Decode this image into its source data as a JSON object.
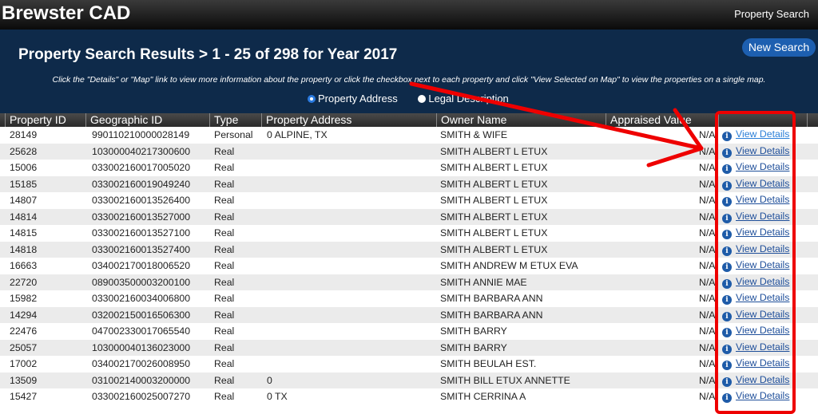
{
  "app": {
    "title": "Brewster CAD",
    "nav_property_search": "Property Search"
  },
  "panel": {
    "results_title": "Property Search Results > 1 - 25 of 298 for Year 2017",
    "new_search": "New Search",
    "instructions": "Click the \"Details\" or \"Map\" link to view more information about the property or click the checkbox next to each property and click \"View Selected on Map\" to view the properties on a single map.",
    "radio_address": "Property Address",
    "radio_legal": "Legal Description",
    "selected_radio": "Property Address"
  },
  "table": {
    "headers": [
      "Property ID",
      "Geographic ID",
      "Type",
      "Property Address",
      "Owner Name",
      "Appraised Value"
    ],
    "details_label": "View Details",
    "rows": [
      {
        "id": "28149",
        "geo": "990110210000028149",
        "type": "Personal",
        "addr": "0 ALPINE, TX",
        "owner": "SMITH & WIFE",
        "value": "N/A"
      },
      {
        "id": "25628",
        "geo": "103000040217300600",
        "type": "Real",
        "addr": "",
        "owner": "SMITH ALBERT L ETUX",
        "value": "N/A"
      },
      {
        "id": "15006",
        "geo": "033002160017005020",
        "type": "Real",
        "addr": "",
        "owner": "SMITH ALBERT L ETUX",
        "value": "N/A"
      },
      {
        "id": "15185",
        "geo": "033002160019049240",
        "type": "Real",
        "addr": "",
        "owner": "SMITH ALBERT L ETUX",
        "value": "N/A"
      },
      {
        "id": "14807",
        "geo": "033002160013526400",
        "type": "Real",
        "addr": "",
        "owner": "SMITH ALBERT L ETUX",
        "value": "N/A"
      },
      {
        "id": "14814",
        "geo": "033002160013527000",
        "type": "Real",
        "addr": "",
        "owner": "SMITH ALBERT L ETUX",
        "value": "N/A"
      },
      {
        "id": "14815",
        "geo": "033002160013527100",
        "type": "Real",
        "addr": "",
        "owner": "SMITH ALBERT L ETUX",
        "value": "N/A"
      },
      {
        "id": "14818",
        "geo": "033002160013527400",
        "type": "Real",
        "addr": "",
        "owner": "SMITH ALBERT L ETUX",
        "value": "N/A"
      },
      {
        "id": "16663",
        "geo": "034002170018006520",
        "type": "Real",
        "addr": "",
        "owner": "SMITH ANDREW M ETUX EVA",
        "value": "N/A"
      },
      {
        "id": "22720",
        "geo": "089003500003200100",
        "type": "Real",
        "addr": "",
        "owner": "SMITH ANNIE MAE",
        "value": "N/A"
      },
      {
        "id": "15982",
        "geo": "033002160034006800",
        "type": "Real",
        "addr": "",
        "owner": "SMITH BARBARA ANN",
        "value": "N/A"
      },
      {
        "id": "14294",
        "geo": "032002150016506300",
        "type": "Real",
        "addr": "",
        "owner": "SMITH BARBARA ANN",
        "value": "N/A"
      },
      {
        "id": "22476",
        "geo": "047002330017065540",
        "type": "Real",
        "addr": "",
        "owner": "SMITH BARRY",
        "value": "N/A"
      },
      {
        "id": "25057",
        "geo": "103000040136023000",
        "type": "Real",
        "addr": "",
        "owner": "SMITH BARRY",
        "value": "N/A"
      },
      {
        "id": "17002",
        "geo": "034002170026008950",
        "type": "Real",
        "addr": "",
        "owner": "SMITH BEULAH EST.",
        "value": "N/A"
      },
      {
        "id": "13509",
        "geo": "031002140003200000",
        "type": "Real",
        "addr": "0",
        "owner": "SMITH BILL ETUX ANNETTE",
        "value": "N/A"
      },
      {
        "id": "15427",
        "geo": "033002160025007270",
        "type": "Real",
        "addr": "0 TX",
        "owner": "SMITH CERRINA A",
        "value": "N/A"
      }
    ]
  },
  "colors": {
    "header_bg": "#0e2a4a",
    "link": "#1f4f9a",
    "annotation": "#e00000"
  }
}
